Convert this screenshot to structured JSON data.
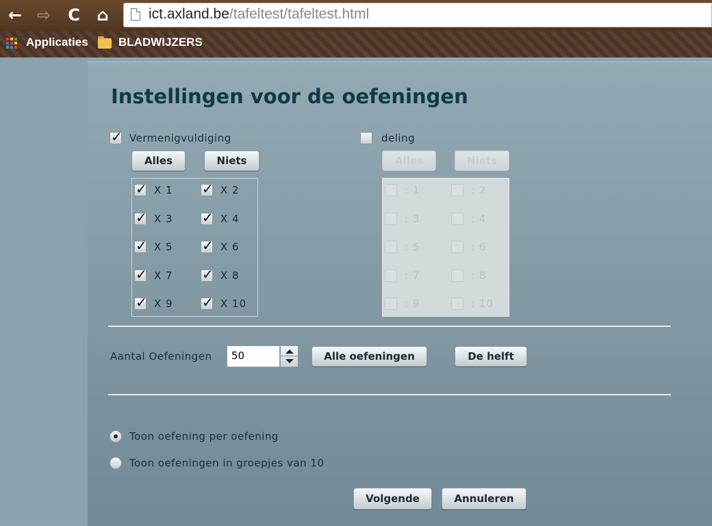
{
  "browser": {
    "url_host": "ict.axland.be",
    "url_path": "/tafeltest/tafeltest.html",
    "back_icon": "←",
    "forward_icon": "⇨",
    "reload_icon": "C",
    "home_icon": "⌂",
    "bookmarks": {
      "apps_label": "Applicaties",
      "folder_label": "BLADWIJZERS"
    }
  },
  "page": {
    "title": "Instellingen voor de oefeningen",
    "multiplication": {
      "label": "Vermenigvuldiging",
      "checked": true,
      "all_button": "Alles",
      "none_button": "Niets",
      "items": [
        "X 1",
        "X 2",
        "X 3",
        "X 4",
        "X 5",
        "X 6",
        "X 7",
        "X 8",
        "X 9",
        "X 10"
      ],
      "check_mark": "✓"
    },
    "division": {
      "label": "deling",
      "checked": false,
      "all_button": "Alles",
      "none_button": "Niets",
      "items": [
        ": 1",
        ": 2",
        ": 3",
        ": 4",
        ": 5",
        ": 6",
        ": 7",
        ": 8",
        ": 9",
        ": 10"
      ]
    },
    "count": {
      "label": "Aantal Oefeningen",
      "value": "50",
      "all_button": "Alle oefeningen",
      "half_button": "De helft"
    },
    "display": {
      "option1": "Toon oefening per oefening",
      "option2": "Toon oefeningen in groepjes van 10",
      "selected": 1
    },
    "next_button": "Volgende",
    "cancel_button": "Annuleren"
  }
}
